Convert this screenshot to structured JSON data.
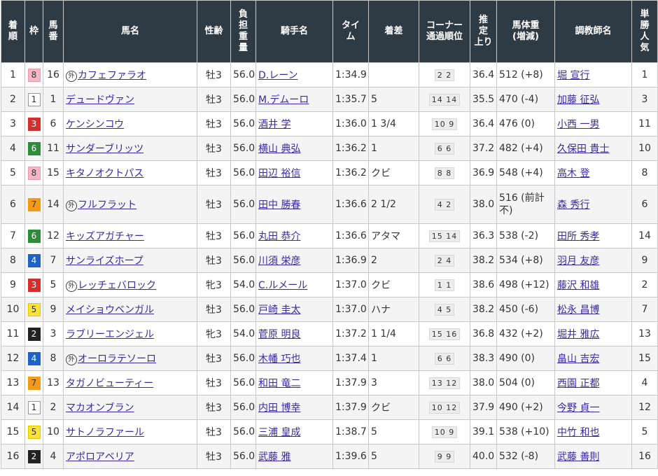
{
  "headers": {
    "finish": "着\n順",
    "gate": "枠",
    "num": "馬\n番",
    "horse": "馬名",
    "sexage": "性齢",
    "weight": "負\n担\n重\n量",
    "jockey": "騎手名",
    "time": "タイ\nム",
    "margin": "着差",
    "corner": "コーナー\n通過順位",
    "last3f": "推\n定\n上り",
    "bodyweight": "馬体重\n(増減)",
    "trainer": "調教師名",
    "pop": "単\n勝\n人\n気"
  },
  "maru_mark": "外",
  "rows": [
    {
      "finish": "1",
      "gate": "8",
      "num": "16",
      "maru": true,
      "horse": "カフェファラオ",
      "sexage": "牡3",
      "weight": "56.0",
      "jockey": "D.レーン",
      "time": "1:34.9",
      "margin": "",
      "corner": "2 2",
      "last3f": "36.4",
      "bw": "512 (+8)",
      "trainer": "堀 宣行",
      "pop": "1"
    },
    {
      "finish": "2",
      "gate": "1",
      "num": "1",
      "maru": false,
      "horse": "デュードヴァン",
      "sexage": "牡3",
      "weight": "56.0",
      "jockey": "M.デムーロ",
      "time": "1:35.7",
      "margin": "5",
      "corner": "14 14",
      "last3f": "35.5",
      "bw": "470 (-4)",
      "trainer": "加藤 征弘",
      "pop": "3"
    },
    {
      "finish": "3",
      "gate": "3",
      "num": "6",
      "maru": false,
      "horse": "ケンシンコウ",
      "sexage": "牡3",
      "weight": "56.0",
      "jockey": "酒井 学",
      "time": "1:36.0",
      "margin": "1 3/4",
      "corner": "10 9",
      "last3f": "36.4",
      "bw": "476 (0)",
      "trainer": "小西 一男",
      "pop": "11"
    },
    {
      "finish": "4",
      "gate": "6",
      "num": "11",
      "maru": false,
      "horse": "サンダーブリッツ",
      "sexage": "牡3",
      "weight": "56.0",
      "jockey": "横山 典弘",
      "time": "1:36.2",
      "margin": "1",
      "corner": "6 6",
      "last3f": "37.2",
      "bw": "482 (+4)",
      "trainer": "久保田 貴士",
      "pop": "10"
    },
    {
      "finish": "5",
      "gate": "8",
      "num": "15",
      "maru": false,
      "horse": "キタノオクトパス",
      "sexage": "牡3",
      "weight": "56.0",
      "jockey": "田辺 裕信",
      "time": "1:36.2",
      "margin": "クビ",
      "corner": "8 8",
      "last3f": "36.9",
      "bw": "548 (+4)",
      "trainer": "高木 登",
      "pop": "8"
    },
    {
      "finish": "6",
      "gate": "7",
      "num": "14",
      "maru": true,
      "horse": "フルフラット",
      "sexage": "牡3",
      "weight": "56.0",
      "jockey": "田中 勝春",
      "time": "1:36.6",
      "margin": "2 1/2",
      "corner": "4 2",
      "last3f": "38.0",
      "bw": "516 (前計不)",
      "trainer": "森 秀行",
      "pop": "6",
      "tall": true
    },
    {
      "finish": "7",
      "gate": "6",
      "num": "12",
      "maru": false,
      "horse": "キッズアガチャー",
      "sexage": "牡3",
      "weight": "56.0",
      "jockey": "丸田 恭介",
      "time": "1:36.6",
      "margin": "アタマ",
      "corner": "15 14",
      "last3f": "36.3",
      "bw": "538 (-2)",
      "trainer": "田所 秀孝",
      "pop": "14"
    },
    {
      "finish": "8",
      "gate": "4",
      "num": "7",
      "maru": false,
      "horse": "サンライズホープ",
      "sexage": "牡3",
      "weight": "56.0",
      "jockey": "川須 栄彦",
      "time": "1:36.9",
      "margin": "2",
      "corner": "2 4",
      "last3f": "38.2",
      "bw": "534 (+8)",
      "trainer": "羽月 友彦",
      "pop": "9"
    },
    {
      "finish": "9",
      "gate": "3",
      "num": "5",
      "maru": true,
      "horse": "レッチェバロック",
      "sexage": "牝3",
      "weight": "54.0",
      "jockey": "C.ルメール",
      "time": "1:37.0",
      "margin": "クビ",
      "corner": "1 1",
      "last3f": "38.6",
      "bw": "498 (+12)",
      "trainer": "藤沢 和雄",
      "pop": "2"
    },
    {
      "finish": "10",
      "gate": "5",
      "num": "9",
      "maru": false,
      "horse": "メイショウベンガル",
      "sexage": "牡3",
      "weight": "56.0",
      "jockey": "戸崎 圭太",
      "time": "1:37.0",
      "margin": "ハナ",
      "corner": "4 5",
      "last3f": "38.2",
      "bw": "450 (-6)",
      "trainer": "松永 昌博",
      "pop": "7"
    },
    {
      "finish": "11",
      "gate": "2",
      "num": "3",
      "maru": false,
      "horse": "ラブリーエンジェル",
      "sexage": "牝3",
      "weight": "54.0",
      "jockey": "菅原 明良",
      "time": "1:37.2",
      "margin": "1 1/4",
      "corner": "15 16",
      "last3f": "36.8",
      "bw": "432 (+2)",
      "trainer": "堀井 雅広",
      "pop": "13"
    },
    {
      "finish": "12",
      "gate": "4",
      "num": "8",
      "maru": true,
      "horse": "オーロラテソーロ",
      "sexage": "牡3",
      "weight": "56.0",
      "jockey": "木幡 巧也",
      "time": "1:37.4",
      "margin": "1",
      "corner": "6 6",
      "last3f": "38.3",
      "bw": "490 (0)",
      "trainer": "畠山 吉宏",
      "pop": "15"
    },
    {
      "finish": "13",
      "gate": "7",
      "num": "13",
      "maru": false,
      "horse": "タガノビューティー",
      "sexage": "牡3",
      "weight": "56.0",
      "jockey": "和田 竜二",
      "time": "1:37.9",
      "margin": "3",
      "corner": "13 12",
      "last3f": "38.0",
      "bw": "504 (0)",
      "trainer": "西園 正都",
      "pop": "4"
    },
    {
      "finish": "14",
      "gate": "1",
      "num": "2",
      "maru": false,
      "horse": "マカオンブラン",
      "sexage": "牡3",
      "weight": "56.0",
      "jockey": "内田 博幸",
      "time": "1:37.9",
      "margin": "クビ",
      "corner": "10 12",
      "last3f": "37.9",
      "bw": "490 (+2)",
      "trainer": "今野 貞一",
      "pop": "12"
    },
    {
      "finish": "15",
      "gate": "5",
      "num": "10",
      "maru": false,
      "horse": "サトノラファール",
      "sexage": "牡3",
      "weight": "56.0",
      "jockey": "三浦 皇成",
      "time": "1:38.7",
      "margin": "5",
      "corner": "10 9",
      "last3f": "39.1",
      "bw": "538 (+10)",
      "trainer": "中竹 和也",
      "pop": "5"
    },
    {
      "finish": "16",
      "gate": "2",
      "num": "4",
      "maru": false,
      "horse": "アポロアベリア",
      "sexage": "牡3",
      "weight": "56.0",
      "jockey": "武藤 雅",
      "time": "1:39.6",
      "margin": "5",
      "corner": "9 9",
      "last3f": "40.0",
      "bw": "532 (-8)",
      "trainer": "武藤 善則",
      "pop": "16"
    }
  ]
}
